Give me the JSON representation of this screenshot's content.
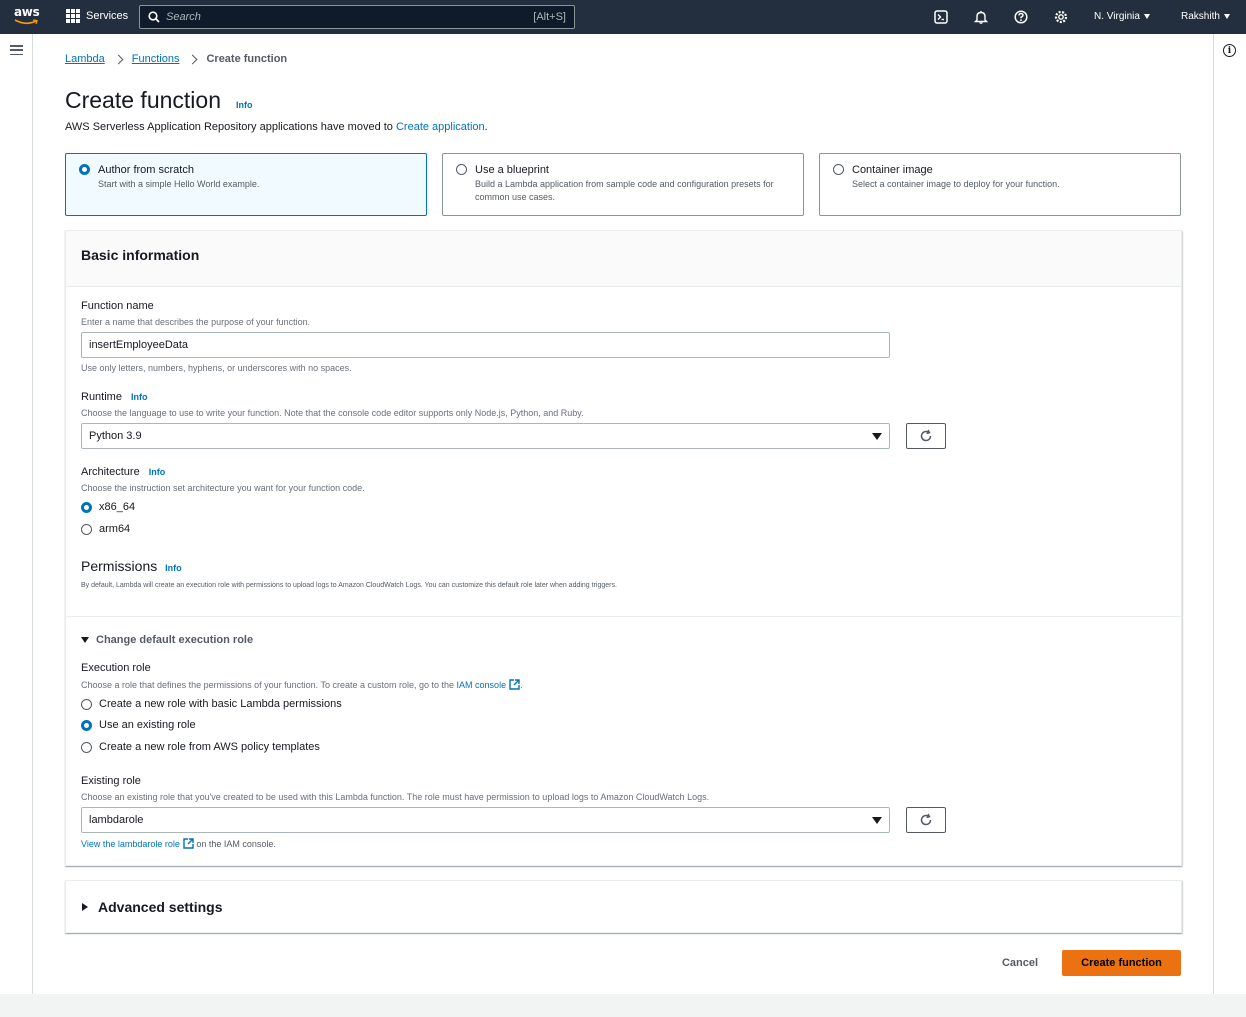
{
  "topnav": {
    "logo_text": "aws",
    "services_label": "Services",
    "search_placeholder": "Search",
    "search_shortcut": "[Alt+S]",
    "region": "N. Virginia",
    "user": "Rakshith",
    "icons": [
      "cloudshell-icon",
      "bell-icon",
      "help-icon",
      "settings-icon"
    ]
  },
  "breadcrumb": {
    "items": [
      "Lambda",
      "Functions"
    ],
    "current": "Create function"
  },
  "header": {
    "title": "Create function",
    "info": "Info",
    "notice_text": "AWS Serverless Application Repository applications have moved to ",
    "notice_link": "Create application",
    "notice_end": "."
  },
  "options": [
    {
      "title": "Author from scratch",
      "desc": "Start with a simple Hello World example.",
      "selected": true
    },
    {
      "title": "Use a blueprint",
      "desc": "Build a Lambda application from sample code and configuration presets for common use cases.",
      "selected": false
    },
    {
      "title": "Container image",
      "desc": "Select a container image to deploy for your function.",
      "selected": false
    }
  ],
  "basic": {
    "heading": "Basic information",
    "function_name": {
      "label": "Function name",
      "desc": "Enter a name that describes the purpose of your function.",
      "value": "insertEmployeeData",
      "hint": "Use only letters, numbers, hyphens, or underscores with no spaces."
    },
    "runtime": {
      "label": "Runtime",
      "info": "Info",
      "desc": "Choose the language to use to write your function. Note that the console code editor supports only Node.js, Python, and Ruby.",
      "value": "Python 3.9"
    },
    "architecture": {
      "label": "Architecture",
      "info": "Info",
      "desc": "Choose the instruction set architecture you want for your function code.",
      "options": [
        "x86_64",
        "arm64"
      ],
      "selected": "x86_64"
    },
    "permissions": {
      "label": "Permissions",
      "info": "Info",
      "desc": "By default, Lambda will create an execution role with permissions to upload logs to Amazon CloudWatch Logs. You can customize this default role later when adding triggers."
    },
    "change_role": {
      "toggle": "Change default execution role",
      "label": "Execution role",
      "desc": "Choose a role that defines the permissions of your function. To create a custom role, go to the ",
      "desc_link": "IAM console",
      "desc_end": ".",
      "options": [
        "Create a new role with basic Lambda permissions",
        "Use an existing role",
        "Create a new role from AWS policy templates"
      ],
      "selected": "Use an existing role"
    },
    "existing_role": {
      "label": "Existing role",
      "desc": "Choose an existing role that you've created to be used with this Lambda function. The role must have permission to upload logs to Amazon CloudWatch Logs.",
      "value": "lambdarole",
      "view_link": "View the lambdarole role",
      "view_suffix": " on the IAM console."
    }
  },
  "advanced": {
    "label": "Advanced settings"
  },
  "footer": {
    "cancel": "Cancel",
    "create": "Create function"
  },
  "colors": {
    "nav_bg": "#232f3e",
    "link": "#0073bb",
    "primary_button": "#ec7211",
    "selected_tile": "#f1faff"
  }
}
